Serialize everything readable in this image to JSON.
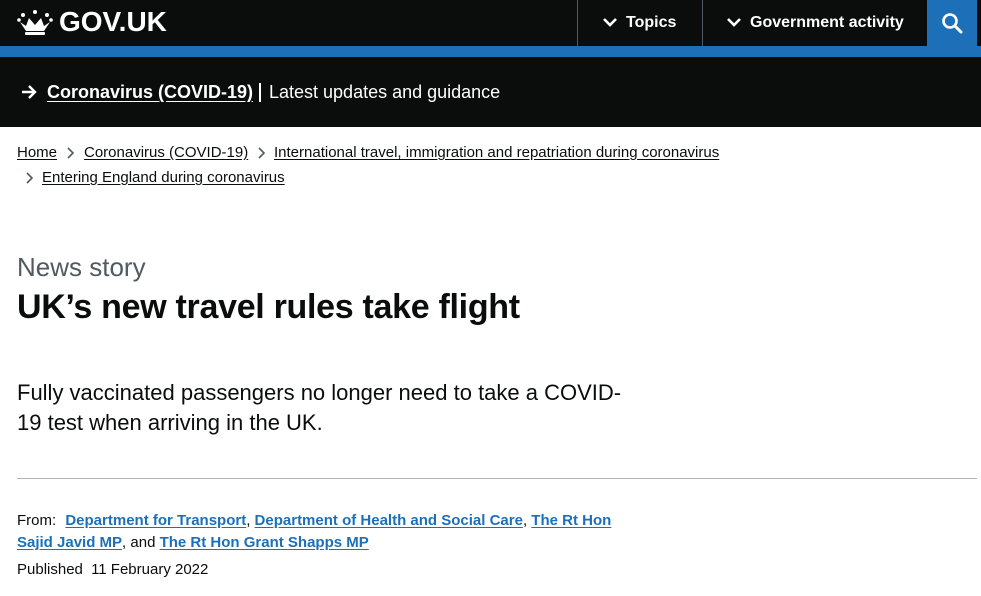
{
  "header": {
    "logo_text": "GOV.UK",
    "nav": {
      "topics_label": "Topics",
      "gov_activity_label": "Government activity"
    },
    "search_icon": "search-icon",
    "colors": {
      "header_bg": "#0b0c0c",
      "brand_blue": "#1d70b8"
    }
  },
  "banner": {
    "link_label": "Coronavirus (COVID-19)",
    "text": "Latest updates and guidance",
    "icon": "arrow-right-icon"
  },
  "breadcrumbs": [
    "Home",
    "Coronavirus (COVID-19)",
    "International travel, immigration and repatriation during coronavirus",
    "Entering England during coronavirus"
  ],
  "page": {
    "caption": "News story",
    "title": "UK’s new travel rules take flight",
    "lead_line1": "Fully vaccinated passengers no longer need to take a COVID-",
    "lead_line2": "19 test when arriving in the UK."
  },
  "metadata": {
    "from_label": "From:",
    "organisations": [
      "Department for Transport",
      "Department of Health and Social Care",
      "The Rt Hon Sajid Javid MP",
      "The Rt Hon Grant Shapps MP"
    ],
    "separator": ",",
    "and_text": ", and",
    "published_label": "Published",
    "published_date": "11 February 2022"
  }
}
